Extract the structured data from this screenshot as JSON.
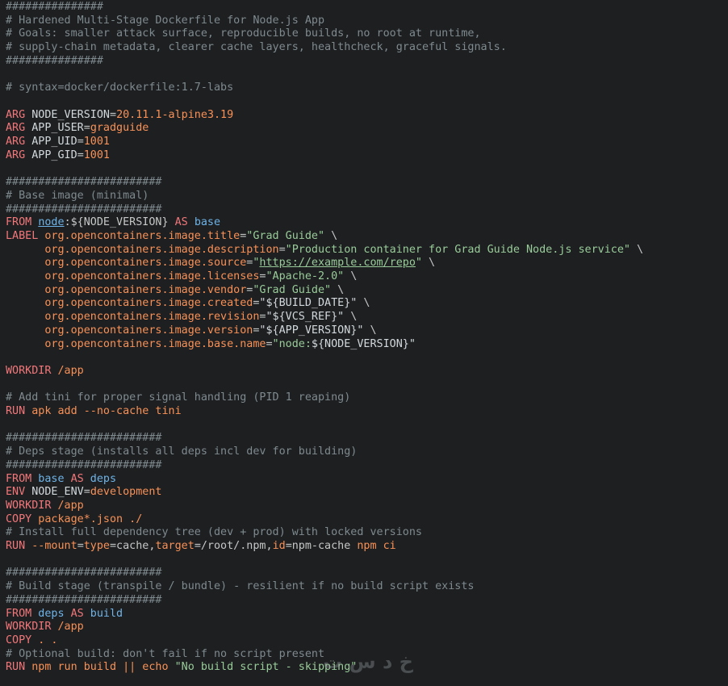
{
  "editor": {
    "language": "dockerfile",
    "colors": {
      "background": "#1d1f21",
      "comment": "#7f8a8f",
      "keyword": "#f2777a",
      "identifier": "#f99157",
      "string": "#99cc99",
      "value": "#c5c8c6",
      "plain": "#d3d8dc"
    },
    "lines": [
      [
        [
          "c",
          "###############"
        ]
      ],
      [
        [
          "c",
          "# Hardened Multi-Stage Dockerfile for Node.js App"
        ]
      ],
      [
        [
          "c",
          "# Goals: smaller attack surface, reproducible builds, no root at runtime,"
        ]
      ],
      [
        [
          "c",
          "# supply-chain metadata, clearer cache layers, healthcheck, graceful signals."
        ]
      ],
      [
        [
          "c",
          "###############"
        ]
      ],
      [],
      [
        [
          "c",
          "# syntax=docker/dockerfile:1.7-labs"
        ]
      ],
      [],
      [
        [
          "kw",
          "ARG"
        ],
        [
          "pl",
          " NODE_VERSION"
        ],
        [
          "pu",
          "="
        ],
        [
          "id",
          "20.11.1-alpine3.19"
        ]
      ],
      [
        [
          "kw",
          "ARG"
        ],
        [
          "pl",
          " APP_USER"
        ],
        [
          "pu",
          "="
        ],
        [
          "id",
          "gradguide"
        ]
      ],
      [
        [
          "kw",
          "ARG"
        ],
        [
          "pl",
          " APP_UID"
        ],
        [
          "pu",
          "="
        ],
        [
          "id",
          "1001"
        ]
      ],
      [
        [
          "kw",
          "ARG"
        ],
        [
          "pl",
          " APP_GID"
        ],
        [
          "pu",
          "="
        ],
        [
          "id",
          "1001"
        ]
      ],
      [],
      [
        [
          "c",
          "########################"
        ]
      ],
      [
        [
          "c",
          "# Base image (minimal)"
        ]
      ],
      [
        [
          "c",
          "########################"
        ]
      ],
      [
        [
          "kw",
          "FROM"
        ],
        [
          "pl",
          " "
        ],
        [
          "nm ul",
          "node"
        ],
        [
          "pu",
          ":${NODE_VERSION} "
        ],
        [
          "kw",
          "AS"
        ],
        [
          "pl",
          " "
        ],
        [
          "nm",
          "base"
        ]
      ],
      [
        [
          "kw",
          "LABEL"
        ],
        [
          "pl",
          " "
        ],
        [
          "id",
          "org.opencontainers.image.title"
        ],
        [
          "pu",
          "="
        ],
        [
          "st",
          "\"Grad Guide\""
        ],
        [
          "pu",
          " \\"
        ]
      ],
      [
        [
          "pl",
          "      "
        ],
        [
          "id",
          "org.opencontainers.image.description"
        ],
        [
          "pu",
          "="
        ],
        [
          "st",
          "\"Production container for Grad Guide Node.js service\""
        ],
        [
          "pu",
          " \\"
        ]
      ],
      [
        [
          "pl",
          "      "
        ],
        [
          "id",
          "org.opencontainers.image.source"
        ],
        [
          "pu",
          "="
        ],
        [
          "st",
          "\""
        ],
        [
          "st ul",
          "https://example.com/repo"
        ],
        [
          "st",
          "\""
        ],
        [
          "pu",
          " \\"
        ]
      ],
      [
        [
          "pl",
          "      "
        ],
        [
          "id",
          "org.opencontainers.image.licenses"
        ],
        [
          "pu",
          "="
        ],
        [
          "st",
          "\"Apache-2.0\""
        ],
        [
          "pu",
          " \\"
        ]
      ],
      [
        [
          "pl",
          "      "
        ],
        [
          "id",
          "org.opencontainers.image.vendor"
        ],
        [
          "pu",
          "="
        ],
        [
          "st",
          "\"Grad Guide\""
        ],
        [
          "pu",
          " \\"
        ]
      ],
      [
        [
          "pl",
          "      "
        ],
        [
          "id",
          "org.opencontainers.image.created"
        ],
        [
          "pu",
          "="
        ],
        [
          "pl",
          "\"${BUILD_DATE}\""
        ],
        [
          "pu",
          " \\"
        ]
      ],
      [
        [
          "pl",
          "      "
        ],
        [
          "id",
          "org.opencontainers.image.revision"
        ],
        [
          "pu",
          "="
        ],
        [
          "pl",
          "\"${VCS_REF}\""
        ],
        [
          "pu",
          " \\"
        ]
      ],
      [
        [
          "pl",
          "      "
        ],
        [
          "id",
          "org.opencontainers.image.version"
        ],
        [
          "pu",
          "="
        ],
        [
          "pl",
          "\"${APP_VERSION}\""
        ],
        [
          "pu",
          " \\"
        ]
      ],
      [
        [
          "pl",
          "      "
        ],
        [
          "id",
          "org.opencontainers.image.base.name"
        ],
        [
          "pu",
          "="
        ],
        [
          "st",
          "\"node:"
        ],
        [
          "pl",
          "${NODE_VERSION}\""
        ]
      ],
      [],
      [
        [
          "kw",
          "WORKDIR"
        ],
        [
          "id",
          " /app"
        ]
      ],
      [],
      [
        [
          "c",
          "# Add tini for proper signal handling (PID 1 reaping)"
        ]
      ],
      [
        [
          "kw",
          "RUN"
        ],
        [
          "id",
          " apk add --no-cache tini"
        ]
      ],
      [],
      [
        [
          "c",
          "########################"
        ]
      ],
      [
        [
          "c",
          "# Deps stage (installs all deps incl dev for building)"
        ]
      ],
      [
        [
          "c",
          "########################"
        ]
      ],
      [
        [
          "kw",
          "FROM"
        ],
        [
          "nm",
          " base "
        ],
        [
          "kw",
          "AS"
        ],
        [
          "nm",
          " deps"
        ]
      ],
      [
        [
          "kw",
          "ENV"
        ],
        [
          "pl",
          " NODE_ENV"
        ],
        [
          "pu",
          "="
        ],
        [
          "id",
          "development"
        ]
      ],
      [
        [
          "kw",
          "WORKDIR"
        ],
        [
          "id",
          " /app"
        ]
      ],
      [
        [
          "kw",
          "COPY"
        ],
        [
          "id",
          " package*.json ./"
        ]
      ],
      [
        [
          "c",
          "# Install full dependency tree (dev + prod) with locked versions"
        ]
      ],
      [
        [
          "kw",
          "RUN"
        ],
        [
          "id",
          " --mount"
        ],
        [
          "pu",
          "="
        ],
        [
          "id",
          "type"
        ],
        [
          "pu",
          "=cache,"
        ],
        [
          "id",
          "target"
        ],
        [
          "pu",
          "=/root/.npm,"
        ],
        [
          "id",
          "id"
        ],
        [
          "pu",
          "=npm-cache "
        ],
        [
          "id",
          "npm ci"
        ]
      ],
      [],
      [
        [
          "c",
          "########################"
        ]
      ],
      [
        [
          "c",
          "# Build stage (transpile / bundle) - resilient if no build script exists"
        ]
      ],
      [
        [
          "c",
          "########################"
        ]
      ],
      [
        [
          "kw",
          "FROM"
        ],
        [
          "nm",
          " deps "
        ],
        [
          "kw",
          "AS"
        ],
        [
          "nm",
          " build"
        ]
      ],
      [
        [
          "kw",
          "WORKDIR"
        ],
        [
          "id",
          " /app"
        ]
      ],
      [
        [
          "kw",
          "COPY"
        ],
        [
          "id",
          " . ."
        ]
      ],
      [
        [
          "c",
          "# Optional build: don't fail if no script present"
        ]
      ],
      [
        [
          "kw",
          "RUN"
        ],
        [
          "id",
          " npm run build || echo "
        ],
        [
          "st",
          "\"No build script - skipping\""
        ]
      ]
    ]
  },
  "watermark": {
    "text": "خ د س ت"
  }
}
